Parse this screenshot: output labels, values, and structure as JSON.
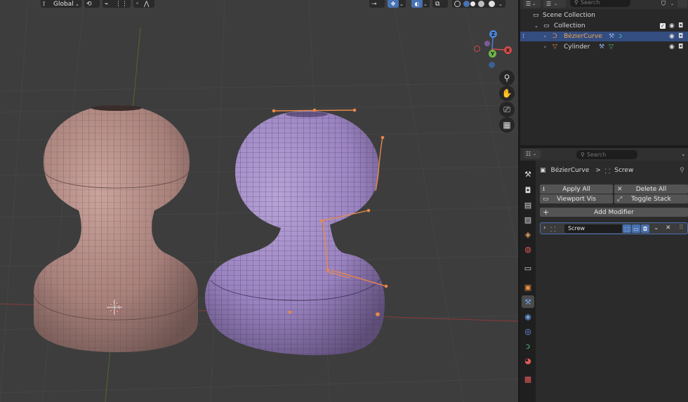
{
  "viewport": {
    "transform_orientation": "Global",
    "gizmo_labels": {
      "z": "Z",
      "y": "Y",
      "x": "X"
    },
    "nav_icons": [
      "zoom-icon",
      "pan-hand-icon",
      "camera-icon",
      "grid-icon"
    ]
  },
  "outliner": {
    "search_placeholder": "Search",
    "scene_collection": "Scene Collection",
    "collection": "Collection",
    "objects": [
      {
        "name": "BézierCurve",
        "selected": true
      },
      {
        "name": "Cylinder",
        "selected": false
      }
    ]
  },
  "properties": {
    "search_placeholder": "Search",
    "breadcrumb_object": "BézierCurve",
    "breadcrumb_separator": ">",
    "breadcrumb_modifier": "Screw",
    "apply_all": "Apply All",
    "delete_all": "Delete All",
    "viewport_vis": "Viewport Vis",
    "toggle_stack": "Toggle Stack",
    "add_modifier": "Add Modifier",
    "modifier_name": "Screw"
  },
  "colors": {
    "selected_row": "#334d80",
    "accent_blue": "#4772b3",
    "curve_orange": "#e8884a"
  }
}
